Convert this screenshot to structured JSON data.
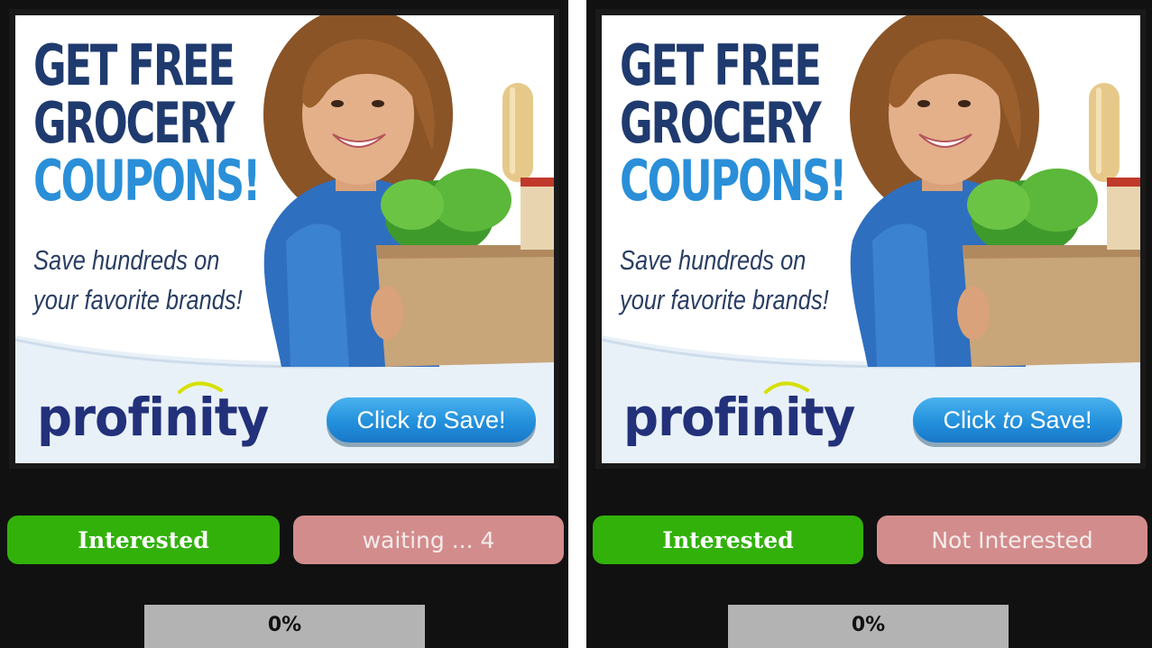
{
  "ad": {
    "headline": [
      "GET FREE",
      "GROCERY",
      "COUPONS!"
    ],
    "tagline": [
      "Save hundreds on",
      "your favorite brands!"
    ],
    "brand": "profinity",
    "cta_prefix": "Click ",
    "cta_italic": "to",
    "cta_suffix": " Save!",
    "colors": {
      "navy": "#1f3a6e",
      "accent_blue": "#2a8fd8",
      "logo": "#22317a",
      "swoosh": "#d6e000"
    }
  },
  "panels": [
    {
      "interested_label": "Interested",
      "not_interested_label": "waiting ... 4",
      "progress_text": "0%",
      "progress_value": 0
    },
    {
      "interested_label": "Interested",
      "not_interested_label": "Not Interested",
      "progress_text": "0%",
      "progress_value": 0
    }
  ],
  "colors": {
    "background": "#111111",
    "interested": "#32b10a",
    "not_interested": "#d38c8c",
    "progress_track": "#b3b3b3"
  }
}
